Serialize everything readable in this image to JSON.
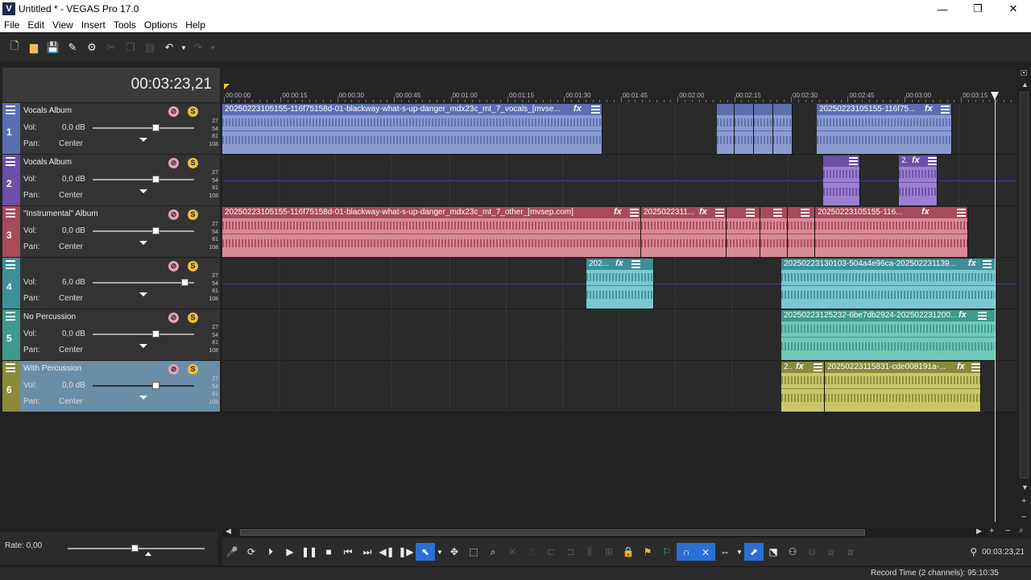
{
  "window": {
    "title": "Untitled * - VEGAS Pro 17.0",
    "icon_letter": "V"
  },
  "menu": [
    "File",
    "Edit",
    "View",
    "Insert",
    "Tools",
    "Options",
    "Help"
  ],
  "timecode": "00:03:23,21",
  "ruler_ticks": [
    "00:00:00",
    "00:00:15",
    "00:00:30",
    "00:00:45",
    "00:01:00",
    "00:01:15",
    "00:01:30",
    "00:01:45",
    "00:02:00",
    "00:02:15",
    "00:02:30",
    "00:02:45",
    "00:03:00",
    "00:03:15"
  ],
  "meter_labels": [
    "27",
    "54",
    "81",
    "108"
  ],
  "labels": {
    "vol": "Vol:",
    "pan": "Pan:",
    "fx": "fx"
  },
  "tracks": [
    {
      "num": "1",
      "name": "Vocals Album",
      "vol": "0,0 dB",
      "pan": "Center",
      "color": "#5a6fb0"
    },
    {
      "num": "2",
      "name": "Vocals Album",
      "vol": "0,0 dB",
      "pan": "Center",
      "color": "#6b4fa8"
    },
    {
      "num": "3",
      "name": "\"Instrumental\" Album",
      "vol": "0,0 dB",
      "pan": "Center",
      "color": "#a84a5a"
    },
    {
      "num": "4",
      "name": "",
      "vol": "6,0 dB",
      "pan": "Center",
      "color": "#3e8f98"
    },
    {
      "num": "5",
      "name": "No Percussion",
      "vol": "0,0 dB",
      "pan": "Center",
      "color": "#3e9a8a"
    },
    {
      "num": "6",
      "name": "With Percussion",
      "vol": "0,0 dB",
      "pan": "Center",
      "color": "#8a8a3a"
    }
  ],
  "events": {
    "t1a": "20250223105155-116f75158d-01-blackway-what-s-up-danger_mdx23c_mt_7_vocals_[mvse...",
    "t1b": "20250223105155-116f75...",
    "t2a": "2.",
    "t3a": "20250223105155-116f75158d-01-blackway-what-s-up-danger_mdx23c_mt_7_other_[mvsep.com]",
    "t3b": "2025022311...",
    "t3c": "20250223105155-116...",
    "t4a": "202...",
    "t4b": "20250223130103-504a4e96ca-202502231139...",
    "t5a": "20250223125232-6be7db2924-202502231200...",
    "t6a": "2..",
    "t6b": "20250223115831-cde008191a-..."
  },
  "rate": "Rate: 0,00",
  "transport_timecode": "00:03:23,21",
  "status": "Record Time (2 channels): 95:10:35"
}
